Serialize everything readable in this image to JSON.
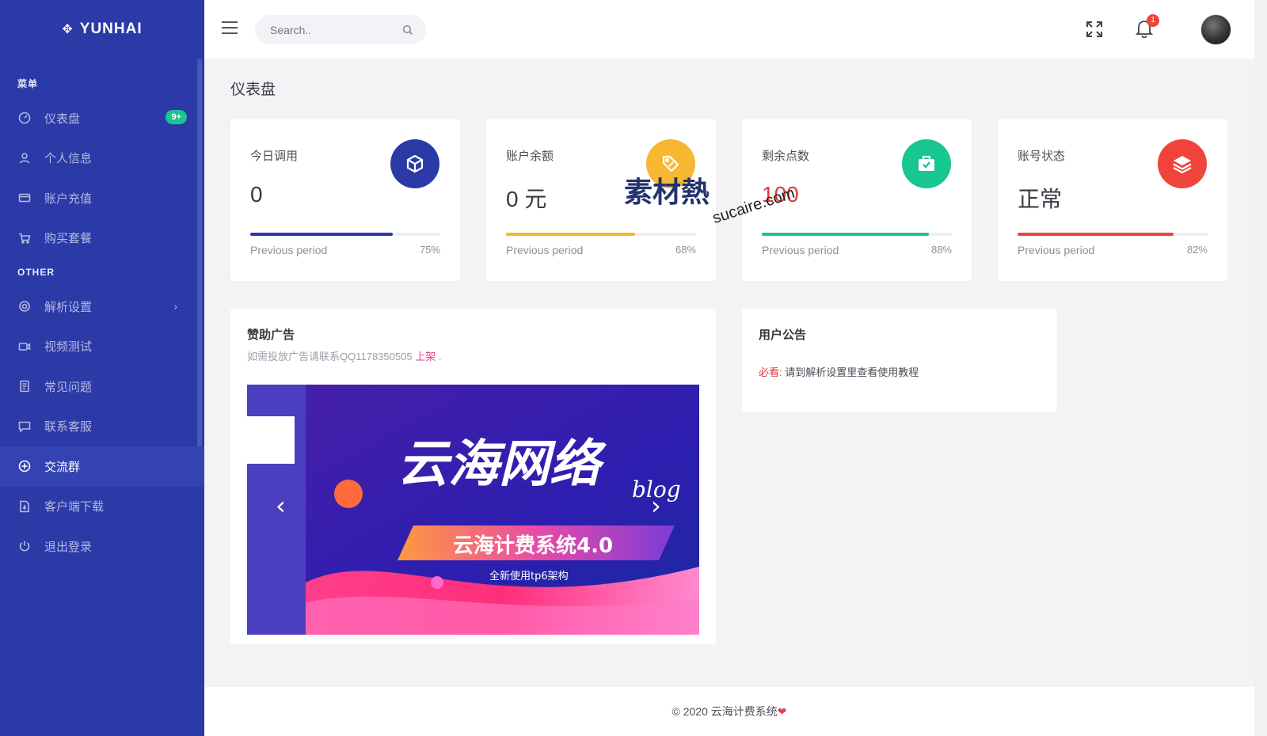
{
  "brand": {
    "name": "YUNHAI"
  },
  "sidebar": {
    "section_menu": "菜单",
    "section_other": "OTHER",
    "items": [
      {
        "label": "仪表盘",
        "icon": "dashboard-icon",
        "badge": "9+"
      },
      {
        "label": "个人信息",
        "icon": "user-icon"
      },
      {
        "label": "账户充值",
        "icon": "credit-card-icon"
      },
      {
        "label": "购买套餐",
        "icon": "cart-icon"
      }
    ],
    "other_items": [
      {
        "label": "解析设置",
        "icon": "settings-icon",
        "chevron": "›"
      },
      {
        "label": "视频测试",
        "icon": "video-icon"
      },
      {
        "label": "常见问题",
        "icon": "document-icon"
      },
      {
        "label": "联系客服",
        "icon": "chat-icon"
      },
      {
        "label": "交流群",
        "icon": "plus-circle-icon"
      },
      {
        "label": "客户端下载",
        "icon": "download-file-icon"
      },
      {
        "label": "退出登录",
        "icon": "power-icon"
      }
    ]
  },
  "topbar": {
    "search_placeholder": "Search..",
    "notification_count": "1"
  },
  "page": {
    "title": "仪表盘"
  },
  "stats": [
    {
      "label": "今日调用",
      "value": "0",
      "pct": "75%",
      "prev": "Previous period",
      "progress": 0.75,
      "color": "#2b3aa6",
      "icon": "cube-icon"
    },
    {
      "label": "账户余额",
      "value": "0 元",
      "pct": "68%",
      "prev": "Previous period",
      "progress": 0.68,
      "color": "#f6b731",
      "icon": "tag-icon"
    },
    {
      "label": "剩余点数",
      "value": "100",
      "pct": "88%",
      "prev": "Previous period",
      "progress": 0.88,
      "color": "#17c690",
      "icon": "briefcase-check-icon"
    },
    {
      "label": "账号状态",
      "value": "正常",
      "pct": "82%",
      "prev": "Previous period",
      "progress": 0.82,
      "color": "#f0443a",
      "icon": "layers-icon"
    }
  ],
  "ad": {
    "title": "赞助广告",
    "subtitle": "如需投放广告请联系QQ1178350505",
    "link": "上架",
    "tail": ".",
    "banner": {
      "headline": "云海网络",
      "headline_suffix": "blog",
      "ribbon": "云海计费系统4.0",
      "caption": "全新使用tp6架构"
    }
  },
  "notice": {
    "title": "用户公告",
    "prefix": "必看:",
    "text": "请到解析设置里查看使用教程"
  },
  "footer": {
    "text": "© 2020 云海计费系统",
    "heart": "❤"
  },
  "watermark": {
    "cn": "素材熱",
    "en": "sucaire.com"
  }
}
